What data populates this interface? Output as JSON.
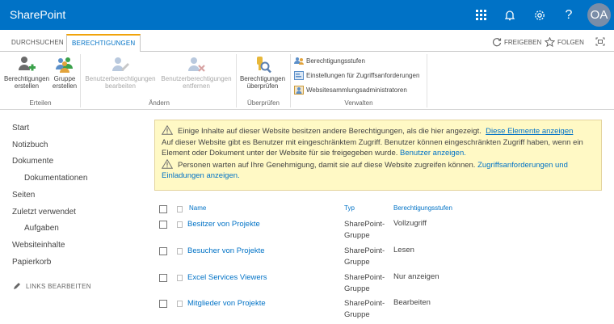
{
  "suitebar": {
    "brand": "SharePoint",
    "avatar_initials": "OA",
    "help_glyph": "?",
    "icons": [
      "app-launcher-icon",
      "bell-icon",
      "gear-icon",
      "help-icon"
    ]
  },
  "tabs": {
    "browse": "DURCHSUCHEN",
    "permissions": "BERECHTIGUNGEN",
    "share": "FREIGEBEN",
    "follow": "FOLGEN"
  },
  "ribbon": {
    "create_permissions": [
      "Berechtigungen",
      "erstellen"
    ],
    "create_group": [
      "Gruppe",
      "erstellen"
    ],
    "group_create": "Erteilen",
    "edit_user_permissions": [
      "Benutzerberechtigungen",
      "bearbeiten"
    ],
    "remove_user_permissions": [
      "Benutzerberechtigungen",
      "entfernen"
    ],
    "group_change": "Ändern",
    "check_permissions": [
      "Berechtigungen",
      "überprüfen"
    ],
    "group_check": "Überprüfen",
    "permission_levels": "Berechtigungsstufen",
    "access_request_settings": "Einstellungen für Zugriffsanforderungen",
    "site_collection_admins": "Websitesammlungsadministratoren",
    "group_manage": "Verwalten"
  },
  "nav": {
    "items": [
      "Start",
      "Notizbuch",
      "Dokumente",
      "Dokumentationen",
      "Seiten",
      "Zuletzt verwendet",
      "Aufgaben",
      "Websiteinhalte",
      "Papierkorb"
    ],
    "edit_links": "LINKS BEARBEITEN"
  },
  "warning": {
    "line1_text": "Einige Inhalte auf dieser Website besitzen andere Berechtigungen, als die hier angezeigt.",
    "line1_link": "Diese Elemente anzeigen",
    "line2_text": "Auf dieser Website gibt es Benutzer mit eingeschränktem Zugriff. Benutzer können eingeschränkten Zugriff haben, wenn ein Element oder Dokument unter der Website für sie freigegeben wurde.",
    "line2_link": "Benutzer anzeigen.",
    "line3_text": "Personen warten auf Ihre Genehmigung, damit sie auf diese Website zugreifen können.",
    "line3_link": "Zugriffsanforderungen und Einladungen anzeigen."
  },
  "table": {
    "headers": {
      "name": "Name",
      "type": "Typ",
      "levels": "Berechtigungsstufen"
    },
    "rows": [
      {
        "name": "Besitzer von Projekte",
        "type": "SharePoint-Gruppe",
        "level": "Vollzugriff"
      },
      {
        "name": "Besucher von Projekte",
        "type": "SharePoint-Gruppe",
        "level": "Lesen"
      },
      {
        "name": "Excel Services Viewers",
        "type": "SharePoint-Gruppe",
        "level": "Nur anzeigen"
      },
      {
        "name": "Mitglieder von Projekte",
        "type": "SharePoint-Gruppe",
        "level": "Bearbeiten"
      }
    ]
  },
  "colors": {
    "suitebar": "#0072c6",
    "accent_tab": "#f0a30a",
    "link": "#0072c6",
    "warning_bg": "#fff9c5"
  }
}
